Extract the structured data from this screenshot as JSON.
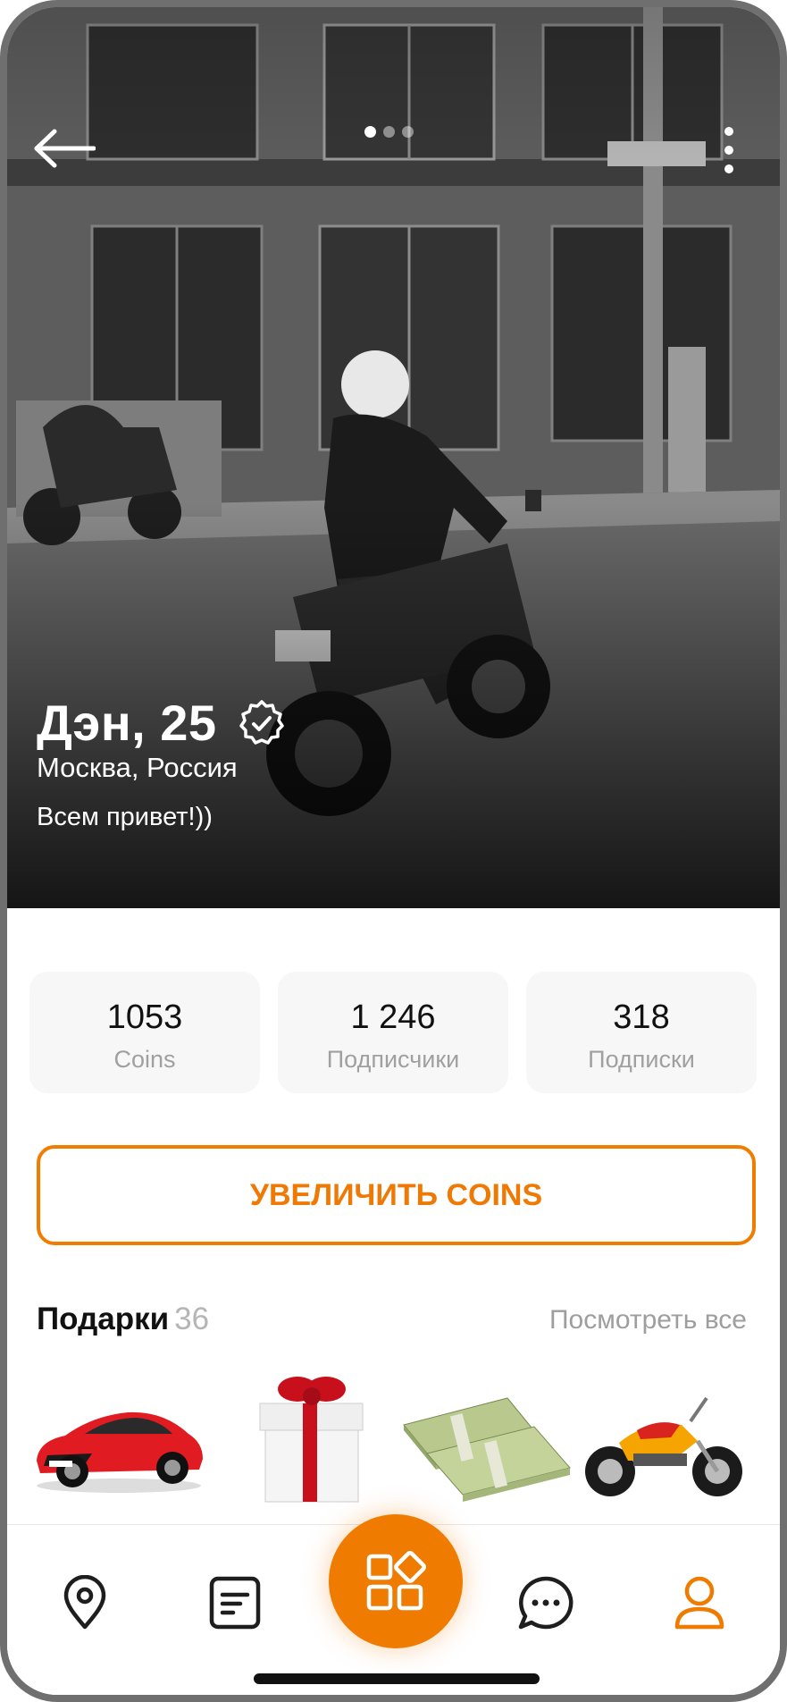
{
  "profile": {
    "name_age": "Дэн, 25",
    "location": "Москва, Россия",
    "status": "Всем привет!))",
    "verified_icon": "verified-badge-icon"
  },
  "carousel": {
    "pages": 3,
    "active_index": 0
  },
  "stats": [
    {
      "value": "1053",
      "label": "Coins"
    },
    {
      "value": "1 246",
      "label": "Подписчики"
    },
    {
      "value": "318",
      "label": "Подписки"
    }
  ],
  "cta": {
    "label": "УВЕЛИЧИТЬ COINS"
  },
  "gifts": {
    "title": "Подарки",
    "count": "36",
    "see_all": "Посмотреть все",
    "items": [
      "car-gift-icon",
      "gift-box-icon",
      "money-stack-icon",
      "motorcycle-gift-icon"
    ]
  },
  "nav": {
    "items": [
      "location-pin-icon",
      "feed-icon",
      "apps-grid-icon",
      "chat-icon",
      "profile-icon"
    ],
    "active": "profile-icon"
  },
  "colors": {
    "accent": "#EF7B00",
    "muted": "#A0A0A0",
    "card_bg": "#F7F7F7"
  }
}
